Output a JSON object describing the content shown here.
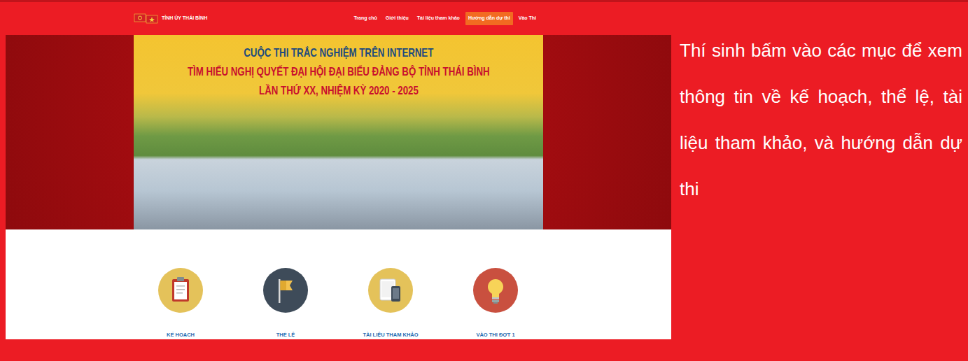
{
  "header": {
    "logo_text": "TỈNH ỦY THÁI BÌNH",
    "nav": [
      {
        "label": "Trang chủ",
        "selected": false
      },
      {
        "label": "Giới thiệu",
        "selected": false
      },
      {
        "label": "Tài liệu tham khảo",
        "selected": false
      },
      {
        "label": "Hướng dẫn dự thi",
        "selected": true
      },
      {
        "label": "Vào Thi",
        "selected": false
      }
    ]
  },
  "banner": {
    "title_lines": [
      {
        "text": "CUỘC THI TRẮC NGHIỆM TRÊN INTERNET",
        "color": "#1d4a7e"
      },
      {
        "text": "TÌM HIỂU NGHỊ QUYẾT ĐẠI HỘI ĐẠI BIỂU ĐẢNG BỘ TỈNH THÁI BÌNH",
        "color": "#c8102e"
      },
      {
        "text": "LẦN THỨ XX, NHIỆM KỲ 2020 - 2025",
        "color": "#c8102e"
      }
    ]
  },
  "features": [
    {
      "label": "KẾ HOẠCH",
      "color": "#e4c25a"
    },
    {
      "label": "THỂ LỆ",
      "color": "#3e4b59"
    },
    {
      "label": "TÀI LIỆU THAM KHẢO",
      "color": "#e4c25a"
    },
    {
      "label": "VÀO THI ĐỢT 1",
      "color": "#c9503f"
    }
  ],
  "caption": "Thí sinh bấm vào các mục để xem thông tin về kế hoạch, thể lệ, tài liệu tham khảo, và hướng dẫn dự thi"
}
